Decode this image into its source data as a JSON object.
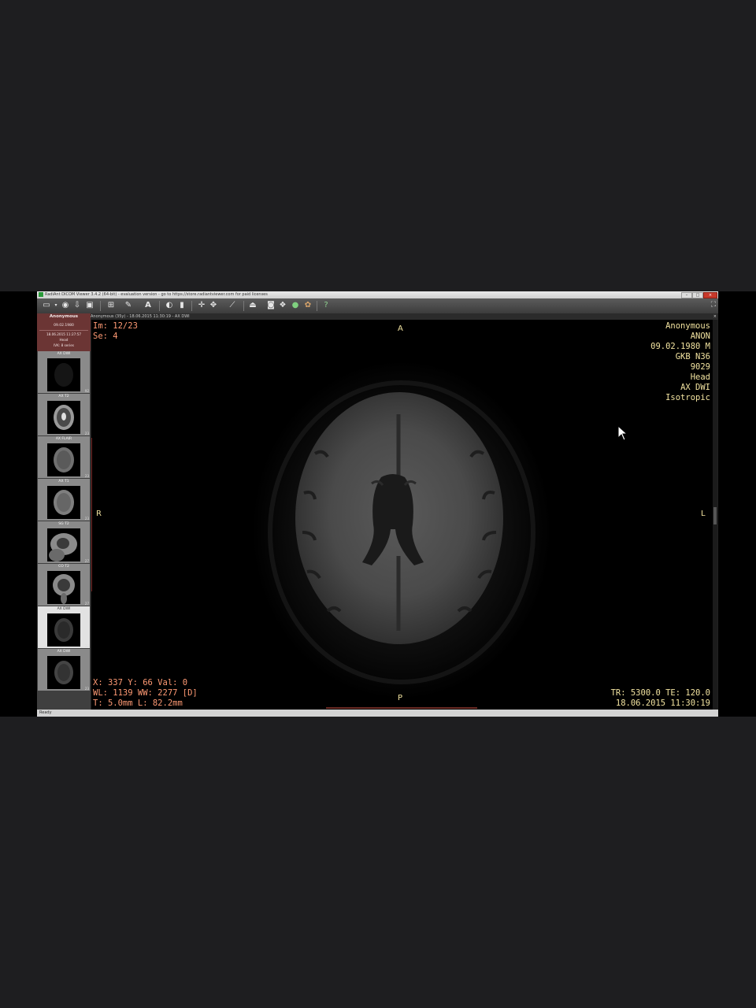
{
  "window": {
    "title": "RadiAnt DICOM Viewer 3.4.2 (64-bit) - evaluation version - go to https://store.radiantviewer.com for paid licenses",
    "controls": {
      "minimize": "–",
      "maximize": "□",
      "close": "×"
    }
  },
  "toolbar": {
    "icons": [
      "folder-open-icon",
      "cd-icon",
      "download-icon",
      "save-icon",
      "layout-grid-icon",
      "wand-icon",
      "text-tool-icon",
      "window-level-icon",
      "contrast-icon",
      "crosshair-icon",
      "pan-icon",
      "measure-line-icon",
      "cine-icon",
      "camera-icon",
      "three-d-icon",
      "globe-icon",
      "settings-icon",
      "help-icon"
    ],
    "corner_glyph": "⛶"
  },
  "patient": {
    "name": "Anonymous",
    "dob": "09.02.1980",
    "study_date": "18.06.2015 11:27:57",
    "body_part": "Head",
    "series_count": "IVK: 8 series"
  },
  "series": [
    {
      "label": "AX DWI",
      "count": "92"
    },
    {
      "label": "AX T2",
      "count": "23"
    },
    {
      "label": "AX FLAIR",
      "count": "23"
    },
    {
      "label": "AX T1",
      "count": "23"
    },
    {
      "label": "SG T2",
      "count": "27"
    },
    {
      "label": "CO T2",
      "count": "27"
    },
    {
      "label": "AX DWI",
      "count": "23",
      "selected": true
    },
    {
      "label": "AX DWI",
      "count": "23"
    }
  ],
  "viewport": {
    "header": "Anonymous (35y) - 18.06.2015 11:30:19 - AX DWI",
    "header_close": "×",
    "top_left": [
      "Im: 12/23",
      "Se: 4"
    ],
    "top_right": [
      "Anonymous",
      "ANON",
      "09.02.1980 M",
      "GKB N36",
      "9029",
      "Head",
      "AX DWI",
      "Isotropic"
    ],
    "bottom_left": [
      "X: 337 Y: 66 Val: 0",
      "WL: 1139 WW: 2277 [D]",
      "T: 5.0mm L: 82.2mm"
    ],
    "bottom_right": [
      "TR: 5300.0 TE: 120.0",
      "18.06.2015 11:30:19"
    ],
    "orientation": {
      "top": "A",
      "bottom": "P",
      "left": "R",
      "right": "L"
    },
    "colors": {
      "overlay_left": "#ff9a74",
      "overlay_right": "#f2e3a0"
    }
  },
  "status": {
    "text": "Ready"
  }
}
